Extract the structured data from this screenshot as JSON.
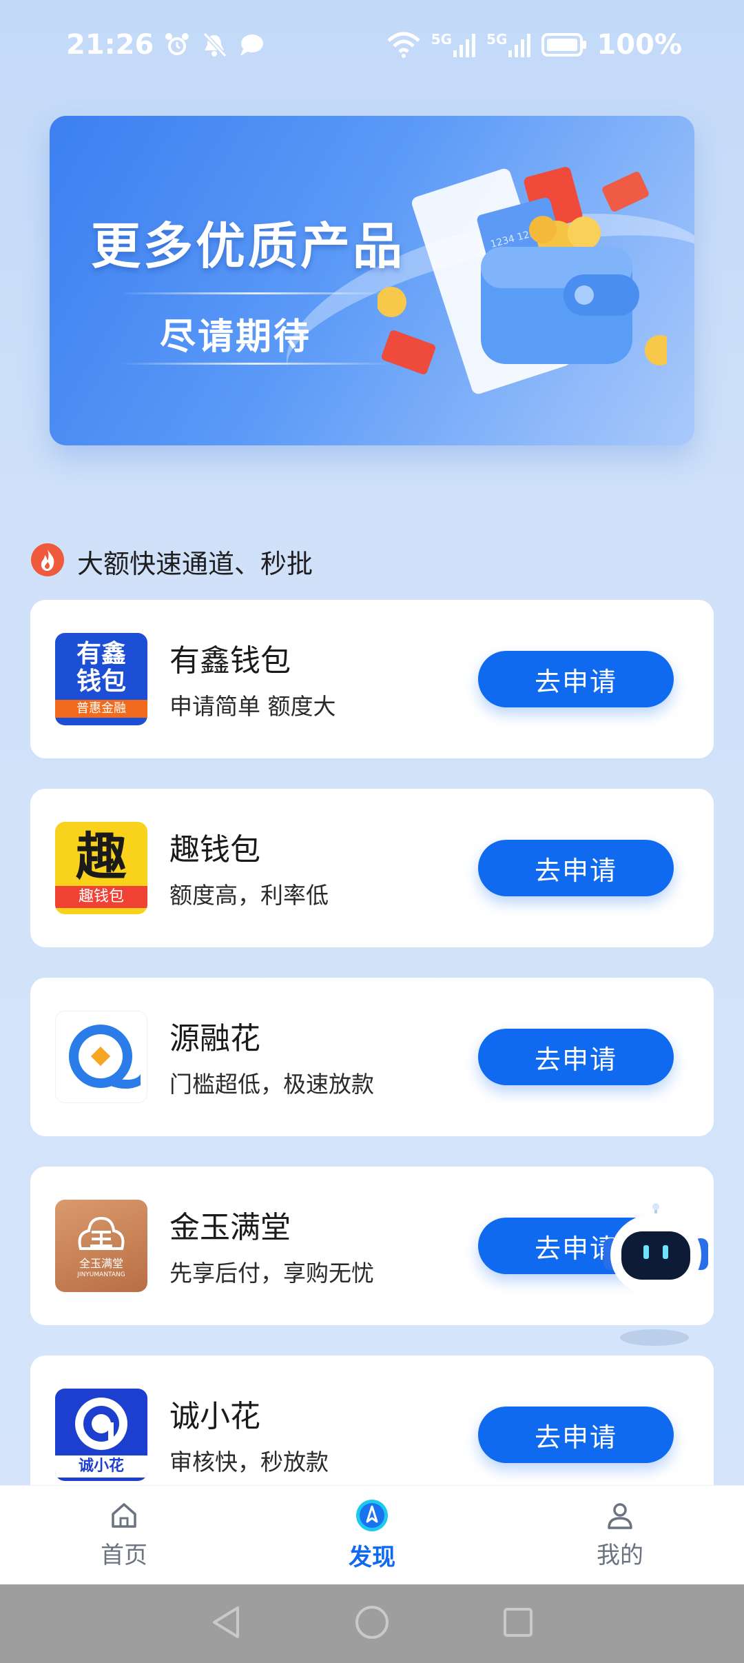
{
  "status_bar": {
    "time": "21:26",
    "battery": "100%",
    "network_1": "5G",
    "network_2": "5G",
    "icons": [
      "alarm-icon",
      "mute-icon",
      "message-icon",
      "wifi-icon",
      "signal-icon",
      "battery-icon"
    ]
  },
  "banner": {
    "title": "更多优质产品",
    "subtitle": "尽请期待",
    "card_number": "1234 123"
  },
  "section": {
    "title": "大额快速通道、秒批",
    "icon": "fire-icon"
  },
  "products": [
    {
      "name": "有鑫钱包",
      "desc": "申请简单 额度大",
      "button": "去申请",
      "logo_line1": "有鑫",
      "logo_line2": "钱包",
      "logo_tag": "普惠金融"
    },
    {
      "name": "趣钱包",
      "desc": "额度高，利率低",
      "button": "去申请",
      "logo_char": "趣",
      "logo_tag": "趣钱包"
    },
    {
      "name": "源融花",
      "desc": "门槛超低，极速放款",
      "button": "去申请"
    },
    {
      "name": "金玉满堂",
      "desc": "先享后付，享购无忧",
      "button": "去申请",
      "logo_cn": "全玉满堂",
      "logo_en": "JINYUMANTANG"
    },
    {
      "name": "诚小花",
      "desc": "审核快，秒放款",
      "button": "去申请",
      "logo_tag": "诚小花"
    }
  ],
  "tabs": [
    {
      "label": "首页",
      "icon": "home-icon",
      "active": false
    },
    {
      "label": "发现",
      "icon": "discover-compass-icon",
      "active": true
    },
    {
      "label": "我的",
      "icon": "profile-icon",
      "active": false
    }
  ],
  "colors": {
    "accent": "#0f6af0",
    "background": "#c8ddf8",
    "inactive_tab": "#6b7380"
  }
}
